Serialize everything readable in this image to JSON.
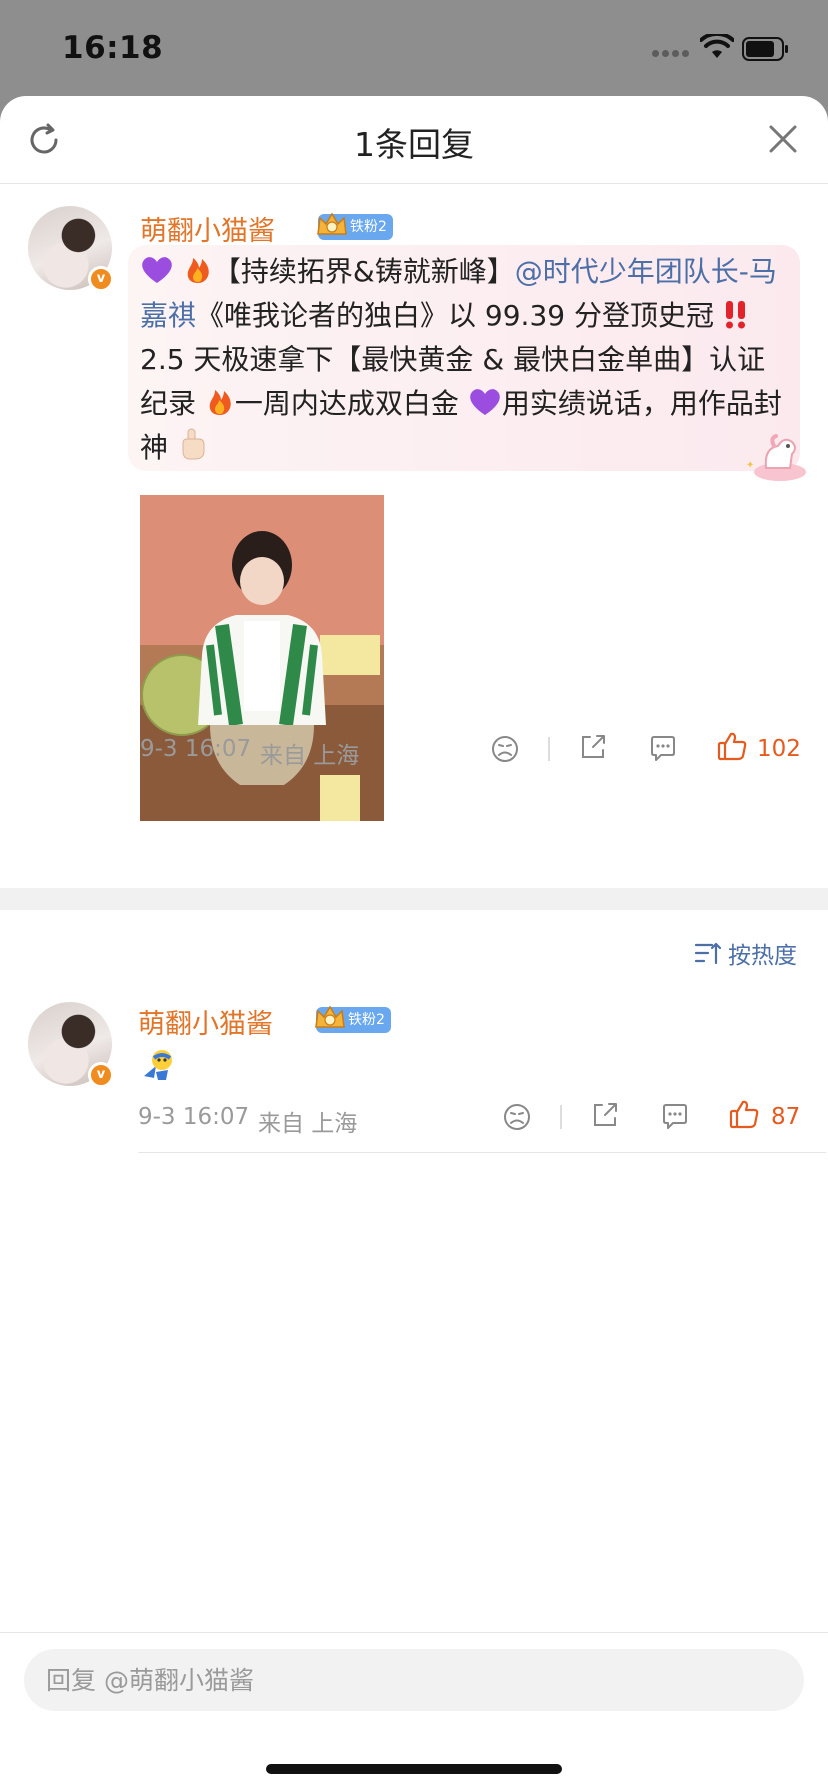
{
  "status_bar": {
    "time": "16:18",
    "icons": [
      "cellular-signal-icon",
      "wifi-icon",
      "battery-icon"
    ]
  },
  "sheet": {
    "title": "1条回复",
    "icons": {
      "left": "refresh-icon",
      "right": "close-icon"
    }
  },
  "main_comment": {
    "username": "萌翻小猫酱",
    "fan_badge": "铁粉2",
    "text_parts": {
      "p1": "【持续拓界&铸就新峰】",
      "mention": "@时代少年团队长-马嘉祺",
      "p2": "《唯我论者的独白》以 99.39 分登顶史冠",
      "p3": "2.5 天极速拿下【最快黄金 & 最快白金单曲】认证纪录",
      "p4": "一周内达成双白金",
      "p5": "用实绩说话，用作品封神"
    },
    "emojis": [
      "purple-heart",
      "fire",
      "double-exclamation",
      "fire",
      "purple-heart",
      "pointing-up"
    ],
    "image_desc_icon": "photo",
    "time": "9-3 16:07",
    "source": "来自 上海",
    "likes": "102"
  },
  "sort": {
    "label": "按热度"
  },
  "reply": {
    "username": "萌翻小猫酱",
    "fan_badge": "铁粉2",
    "emoji": "superhero-emoji",
    "time": "9-3 16:07",
    "source": "来自 上海",
    "likes": "87"
  },
  "input": {
    "placeholder": "回复 @萌翻小猫酱"
  },
  "colors": {
    "username": "#e1762a",
    "mention": "#4d6fa8",
    "like": "#e65a1e",
    "meta": "#9a9a9a",
    "fan_badge": "#69a8ef"
  }
}
